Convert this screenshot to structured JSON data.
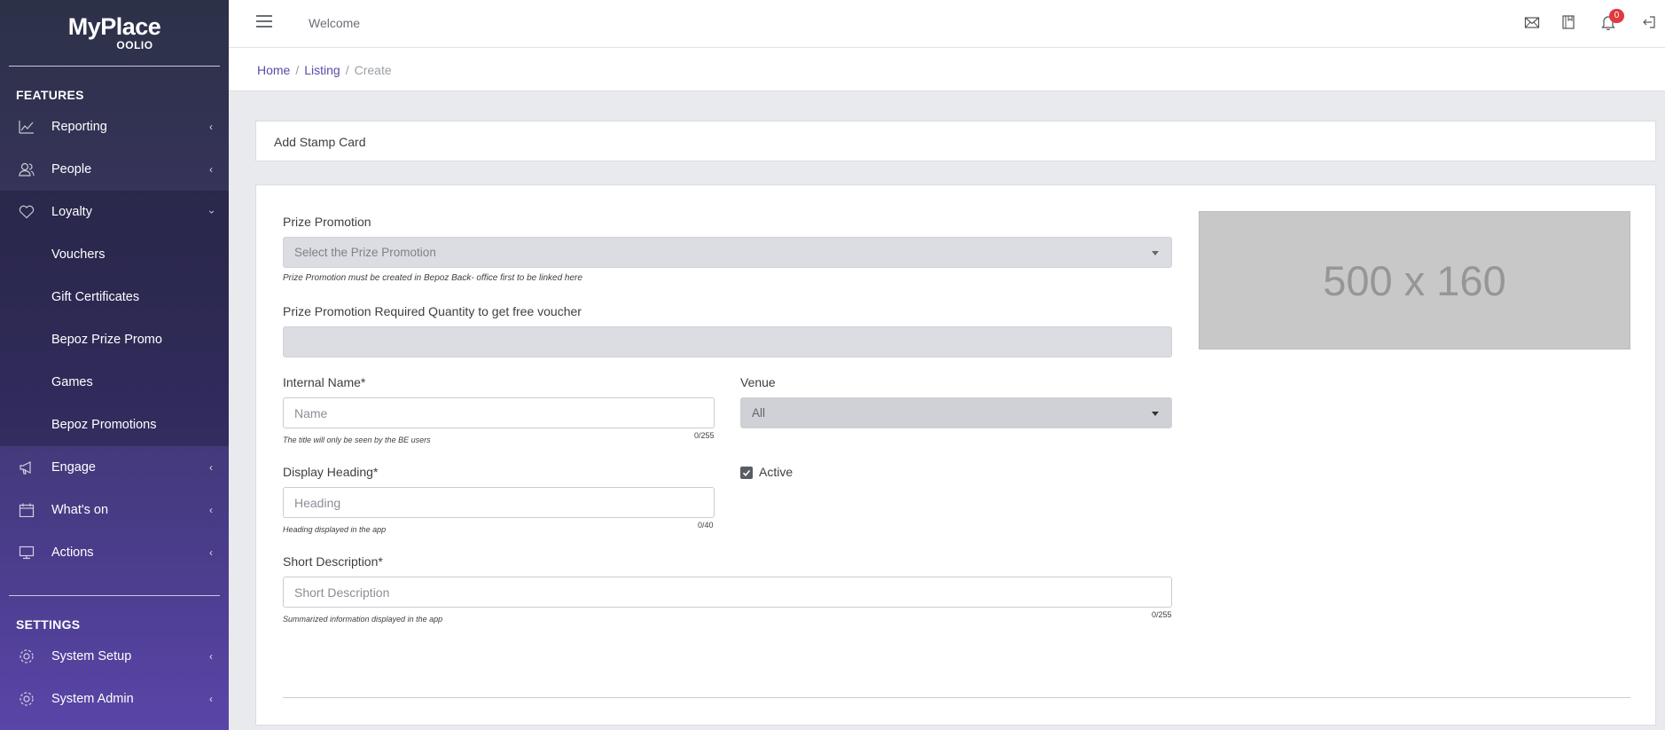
{
  "brand": {
    "name": "MyPlace",
    "sub": "OOLIO"
  },
  "sidebar": {
    "features_heading": "FEATURES",
    "settings_heading": "SETTINGS",
    "items": [
      {
        "label": "Reporting",
        "icon": "chart-line-icon"
      },
      {
        "label": "People",
        "icon": "people-icon"
      },
      {
        "label": "Loyalty",
        "icon": "heart-icon"
      },
      {
        "label": "Engage",
        "icon": "megaphone-icon"
      },
      {
        "label": "What's on",
        "icon": "calendar-icon"
      },
      {
        "label": "Actions",
        "icon": "monitor-icon"
      }
    ],
    "loyalty_sub": [
      "Vouchers",
      "Gift Certificates",
      "Bepoz Prize Promo",
      "Games",
      "Bepoz Promotions"
    ],
    "settings_items": [
      {
        "label": "System Setup",
        "icon": "gear-icon"
      },
      {
        "label": "System Admin",
        "icon": "gear-icon"
      }
    ]
  },
  "topbar": {
    "welcome": "Welcome",
    "notification_count": "0"
  },
  "breadcrumb": {
    "home": "Home",
    "listing": "Listing",
    "current": "Create"
  },
  "page": {
    "title": "Add Stamp Card"
  },
  "form": {
    "prize_promotion": {
      "label": "Prize Promotion",
      "placeholder": "Select the Prize Promotion",
      "hint": "Prize Promotion must be created in Bepoz Back- office first to be linked here"
    },
    "required_qty": {
      "label": "Prize Promotion Required Quantity to get free voucher",
      "value": ""
    },
    "internal_name": {
      "label": "Internal Name*",
      "placeholder": "Name",
      "hint": "The title will only be seen by the BE users",
      "counter": "0/255"
    },
    "venue": {
      "label": "Venue",
      "value": "All"
    },
    "display_heading": {
      "label": "Display Heading*",
      "placeholder": "Heading",
      "hint": "Heading displayed in the app",
      "counter": "0/40"
    },
    "active": {
      "label": "Active",
      "checked": true
    },
    "short_description": {
      "label": "Short Description*",
      "placeholder": "Short Description",
      "hint": "Summarized information displayed in the app",
      "counter": "0/255"
    },
    "image_placeholder": "500 x 160"
  }
}
